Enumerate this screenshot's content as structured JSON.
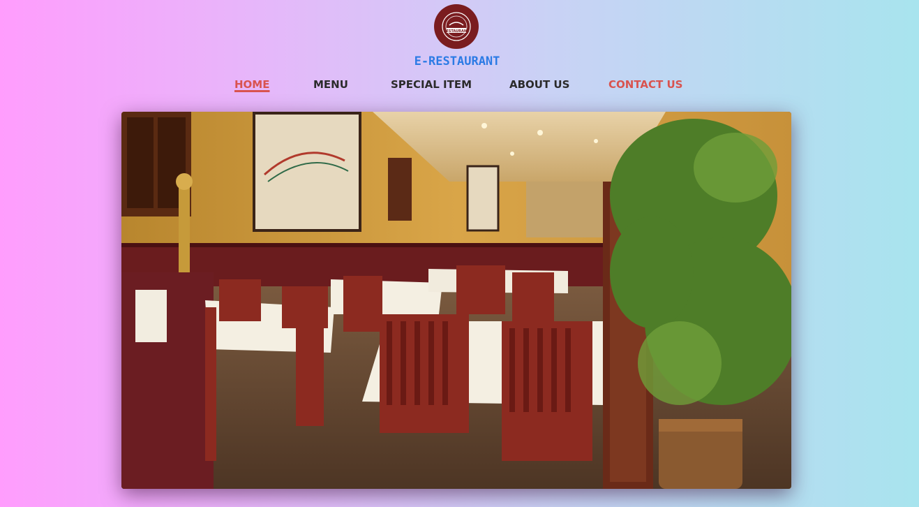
{
  "brand": {
    "name": "E-RESTAURANT",
    "logo_text": "RESTAURANT"
  },
  "nav": {
    "items": [
      {
        "label": "HOME",
        "state": "active"
      },
      {
        "label": "MENU",
        "state": "normal"
      },
      {
        "label": "SPECIAL ITEM",
        "state": "normal"
      },
      {
        "label": "ABOUT US",
        "state": "normal"
      },
      {
        "label": "CONTACT US",
        "state": "highlight"
      }
    ]
  },
  "hero": {
    "description": "Restaurant dining room photo with tables, red wooden chairs, framed art and a bamboo plant"
  },
  "colors": {
    "accent": "#d9534f",
    "brand_blue": "#2c7be5",
    "logo_bg": "#7a1c1f",
    "gradient_left": "#ff9dfd",
    "gradient_right": "#a8e4ee"
  }
}
